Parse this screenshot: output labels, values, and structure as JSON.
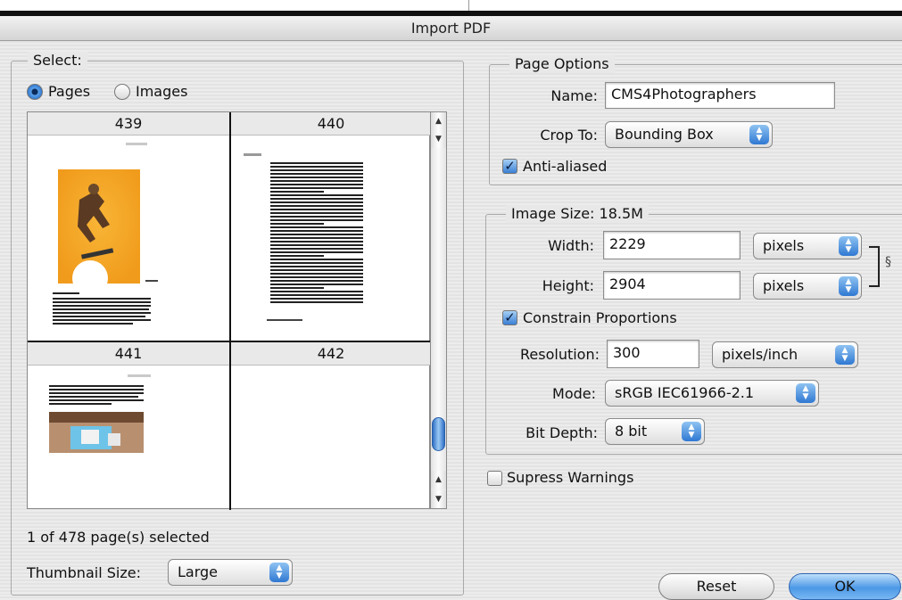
{
  "window": {
    "title": "Import PDF"
  },
  "select": {
    "legend": "Select:",
    "radio_pages": "Pages",
    "radio_images": "Images",
    "selected_mode": "Pages",
    "thumbnails": [
      {
        "page": "439"
      },
      {
        "page": "440"
      },
      {
        "page": "441"
      },
      {
        "page": "442"
      }
    ],
    "status": "1 of 478 page(s) selected",
    "thumbnail_size_label": "Thumbnail Size:",
    "thumbnail_size_value": "Large"
  },
  "page_options": {
    "legend": "Page Options",
    "name_label": "Name:",
    "name_value": "CMS4Photographers",
    "crop_label": "Crop To:",
    "crop_value": "Bounding Box",
    "antialiased_label": "Anti-aliased",
    "antialiased_checked": true
  },
  "image_size": {
    "legend": "Image Size: 18.5M",
    "width_label": "Width:",
    "width_value": "2229",
    "width_unit": "pixels",
    "height_label": "Height:",
    "height_value": "2904",
    "height_unit": "pixels",
    "constrain_label": "Constrain Proportions",
    "constrain_checked": true,
    "resolution_label": "Resolution:",
    "resolution_value": "300",
    "resolution_unit": "pixels/inch",
    "mode_label": "Mode:",
    "mode_value": "sRGB IEC61966-2.1",
    "bitdepth_label": "Bit Depth:",
    "bitdepth_value": "8 bit"
  },
  "suppress_warnings": {
    "label": "Supress Warnings",
    "checked": false
  },
  "buttons": {
    "reset": "Reset",
    "ok": "OK"
  },
  "colors": {
    "accent": "#3a7fd4",
    "thumb_bg": "#f5a623"
  }
}
